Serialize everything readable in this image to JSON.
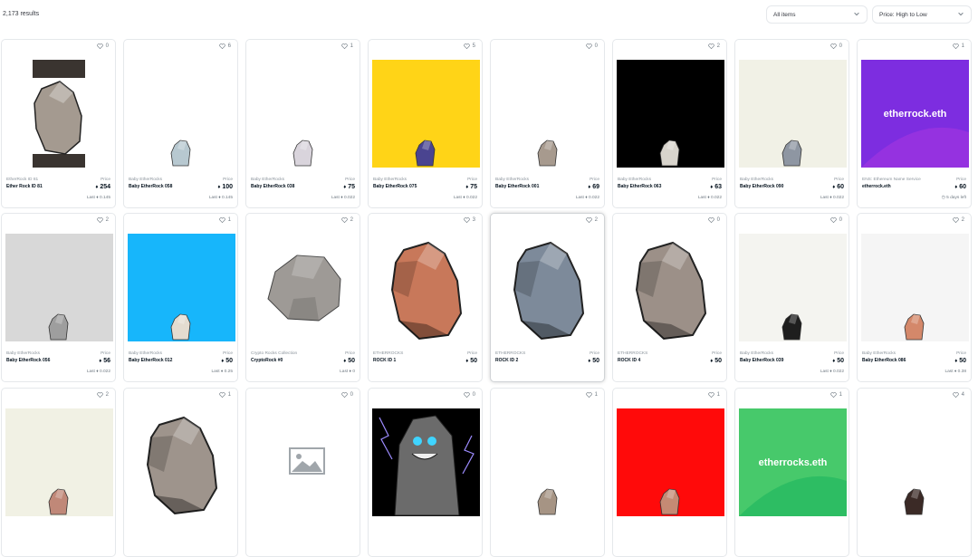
{
  "results_count": "2,173 results",
  "filters": {
    "items_select": "All items",
    "sort_select": "Price: High to Low"
  },
  "cards": [
    {
      "likes": "0",
      "collection": "EtherRock ID 81",
      "name": "Ether Rock ID 81",
      "price_label": "Price",
      "price": "254",
      "last": "Last ♦ 0.145",
      "art": "rock-box",
      "bg": "#ffffff"
    },
    {
      "likes": "6",
      "collection": "Baby EtherRocks",
      "name": "Baby EtherRock 058",
      "price_label": "Price",
      "price": "100",
      "last": "Last ♦ 0.145",
      "art": "small",
      "bg": "#ffffff",
      "rock": "#b7c8d0"
    },
    {
      "likes": "1",
      "collection": "Baby EtherRocks",
      "name": "Baby EtherRock 038",
      "price_label": "Price",
      "price": "75",
      "last": "Last ♦ 0.022",
      "art": "small",
      "bg": "#ffffff",
      "rock": "#d9d4dc"
    },
    {
      "likes": "5",
      "collection": "Baby EtherRocks",
      "name": "Baby EtherRock 075",
      "price_label": "Price",
      "price": "75",
      "last": "Last ♦ 0.022",
      "art": "small",
      "bg": "#ffd417",
      "rock": "#4a4490"
    },
    {
      "likes": "0",
      "collection": "Baby EtherRocks",
      "name": "Baby EtherRock 001",
      "price_label": "Price",
      "price": "69",
      "last": "Last ♦ 0.022",
      "art": "small",
      "bg": "#ffffff",
      "rock": "#a79a8e"
    },
    {
      "likes": "2",
      "collection": "Baby EtherRocks",
      "name": "Baby EtherRock 063",
      "price_label": "Price",
      "price": "63",
      "last": "Last ♦ 0.022",
      "art": "small",
      "bg": "#000000",
      "rock": "#d8d4cc"
    },
    {
      "likes": "0",
      "collection": "Baby EtherRocks",
      "name": "Baby EtherRock 090",
      "price_label": "Price",
      "price": "60",
      "last": "Last ♦ 0.022",
      "art": "small",
      "bg": "#f1f1e6",
      "rock": "#8e96a2"
    },
    {
      "likes": "1",
      "collection": "ENS: Ethereum Name Service",
      "name": "etherrock.eth",
      "price_label": "Price",
      "price": "60",
      "last": "◷ 5 days left",
      "art": "ens",
      "ens_text": "etherrock.eth",
      "bg": "#7d2de0",
      "bg2": "#a035e0"
    },
    {
      "likes": "2",
      "collection": "Baby EtherRocks",
      "name": "Baby EtherRock 056",
      "price_label": "Price",
      "price": "56",
      "last": "Last ♦ 0.022",
      "art": "small",
      "bg": "#d8d8d8",
      "rock": "#9e9e9e"
    },
    {
      "likes": "1",
      "collection": "Baby EtherRocks",
      "name": "Baby EtherRock 012",
      "price_label": "Price",
      "price": "50",
      "last": "Last ♦ 0.25",
      "art": "small",
      "bg": "#17b6fb",
      "rock": "#e4dcd0"
    },
    {
      "likes": "2",
      "collection": "Crypto Rocks Collection",
      "name": "CryptoRock #0",
      "price_label": "Price",
      "price": "50",
      "last": "Last ♦ 0",
      "art": "crypto",
      "bg": "#ffffff"
    },
    {
      "likes": "3",
      "collection": "ETHERROCKS",
      "name": "ROCK ID 1",
      "price_label": "Price",
      "price": "50",
      "last": "",
      "art": "big",
      "bg": "#ffffff",
      "rock": "#c8785a"
    },
    {
      "likes": "2",
      "collection": "ETHERROCKS",
      "name": "ROCK ID 2",
      "price_label": "Price",
      "price": "50",
      "last": "",
      "art": "big",
      "bg": "#ffffff",
      "rock": "#7d8a9a",
      "highlight": true
    },
    {
      "likes": "0",
      "collection": "ETHERROCKS",
      "name": "ROCK ID 4",
      "price_label": "Price",
      "price": "50",
      "last": "",
      "art": "big",
      "bg": "#ffffff",
      "rock": "#9c9088"
    },
    {
      "likes": "0",
      "collection": "Baby EtherRocks",
      "name": "Baby EtherRock 039",
      "price_label": "Price",
      "price": "50",
      "last": "Last ♦ 0.022",
      "art": "small",
      "bg": "#f4f4f0",
      "rock": "#1e1e1e"
    },
    {
      "likes": "2",
      "collection": "Baby EtherRocks",
      "name": "Baby EtherRock 086",
      "price_label": "Price",
      "price": "50",
      "last": "Last ♦ 0.38",
      "art": "small",
      "bg": "#f5f5f5",
      "rock": "#d4886a"
    },
    {
      "likes": "2",
      "art": "small",
      "bg": "#f1f1e4",
      "rock": "#c08878"
    },
    {
      "likes": "1",
      "art": "big",
      "bg": "#ffffff",
      "rock": "#9e948c"
    },
    {
      "likes": "0",
      "art": "placeholder",
      "bg": "#ffffff"
    },
    {
      "likes": "0",
      "art": "ghost",
      "bg": "#000000"
    },
    {
      "likes": "1",
      "art": "small",
      "bg": "#ffffff",
      "rock": "#a69484"
    },
    {
      "likes": "1",
      "art": "small",
      "bg": "#ff0a0a",
      "rock": "#c58a74"
    },
    {
      "likes": "1",
      "art": "ens",
      "ens_text": "etherrocks.eth",
      "bg": "#47c96b",
      "bg2": "#22b860"
    },
    {
      "likes": "4",
      "art": "small",
      "bg": "#ffffff",
      "rock": "#3b2a26"
    }
  ]
}
